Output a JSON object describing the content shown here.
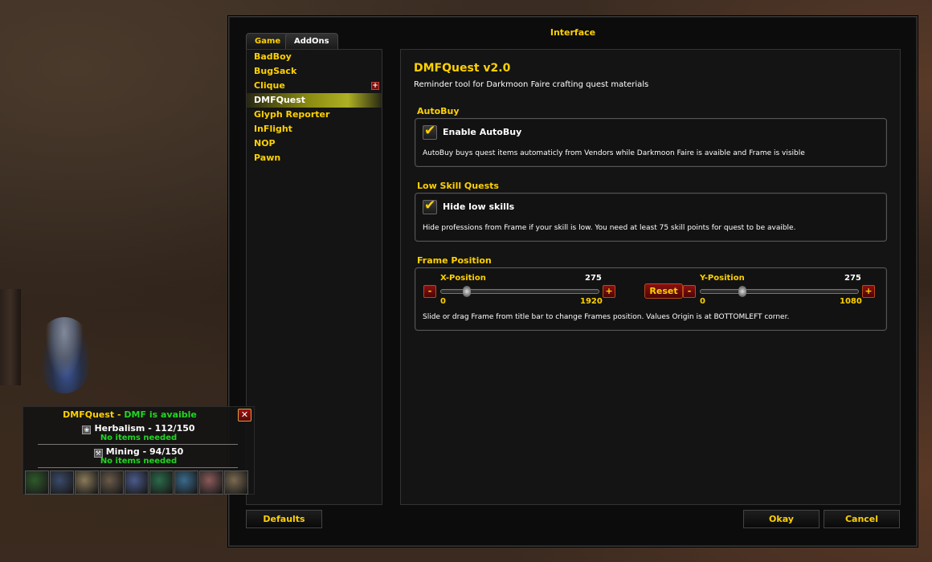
{
  "interface": {
    "title": "Interface",
    "tabs": [
      {
        "label": "Game"
      },
      {
        "label": "AddOns"
      }
    ],
    "addons": [
      {
        "label": "BadBoy"
      },
      {
        "label": "BugSack"
      },
      {
        "label": "Clique",
        "expand_glyph": "+"
      },
      {
        "label": "DMFQuest"
      },
      {
        "label": "Glyph Reporter"
      },
      {
        "label": "InFlight"
      },
      {
        "label": "NOP"
      },
      {
        "label": "Pawn"
      }
    ],
    "selected_addon": "DMFQuest",
    "buttons": {
      "defaults": "Defaults",
      "okay": "Okay",
      "cancel": "Cancel"
    }
  },
  "content": {
    "title": "DMFQuest v2.0",
    "description": "Reminder tool for Darkmoon Faire crafting quest materials",
    "autobuy": {
      "section_label": "AutoBuy",
      "checkbox_label": "Enable AutoBuy",
      "checked": true,
      "help": "AutoBuy buys quest items automaticly from Vendors while Darkmoon Faire is avaible and Frame is visible"
    },
    "low_skill": {
      "section_label": "Low Skill Quests",
      "checkbox_label": "Hide low skills",
      "checked": true,
      "help": "Hide professions from Frame if your skill is low. You need at least 75 skill points for quest to be avaible."
    },
    "frame_position": {
      "section_label": "Frame Position",
      "x": {
        "label": "X-Position",
        "value": "275",
        "min": "0",
        "max": "1920",
        "fraction": 0.143
      },
      "y": {
        "label": "Y-Position",
        "value": "275",
        "min": "0",
        "max": "1080",
        "fraction": 0.255
      },
      "minus": "-",
      "plus": "+",
      "reset": "Reset",
      "help": "Slide or drag Frame from title bar to change Frames position. Values Origin is at BOTTOMLEFT corner."
    },
    "checkmark_glyph": "✔"
  },
  "dmf_frame": {
    "name": "DMFQuest",
    "separator": " - ",
    "status": "DMF is avaible",
    "close_glyph": "✕",
    "professions": [
      {
        "icon": "herbalism-icon",
        "label": "Herbalism - 112/150",
        "status": "No items needed"
      },
      {
        "icon": "mining-icon",
        "label": "Mining - 94/150",
        "status": "No items needed"
      }
    ],
    "item_icons": [
      {
        "name": "herb-item-icon",
        "color": "#2e5a2a"
      },
      {
        "name": "box-item-icon",
        "color": "#3a4a6a"
      },
      {
        "name": "bag-item-icon",
        "color": "#8a7a5a"
      },
      {
        "name": "scroll-item-icon",
        "color": "#6a5a4a"
      },
      {
        "name": "armor-item-icon",
        "color": "#4a5a8a"
      },
      {
        "name": "gem-item-icon",
        "color": "#2a6a4a"
      },
      {
        "name": "book-item-icon",
        "color": "#3a6a8a"
      },
      {
        "name": "egg-item-icon",
        "color": "#8a5a5a"
      },
      {
        "name": "parchment-item-icon",
        "color": "#7a6a50"
      }
    ]
  },
  "colors": {
    "gold": "#ffd100",
    "green_status": "#21d621",
    "panel": "#141414"
  }
}
